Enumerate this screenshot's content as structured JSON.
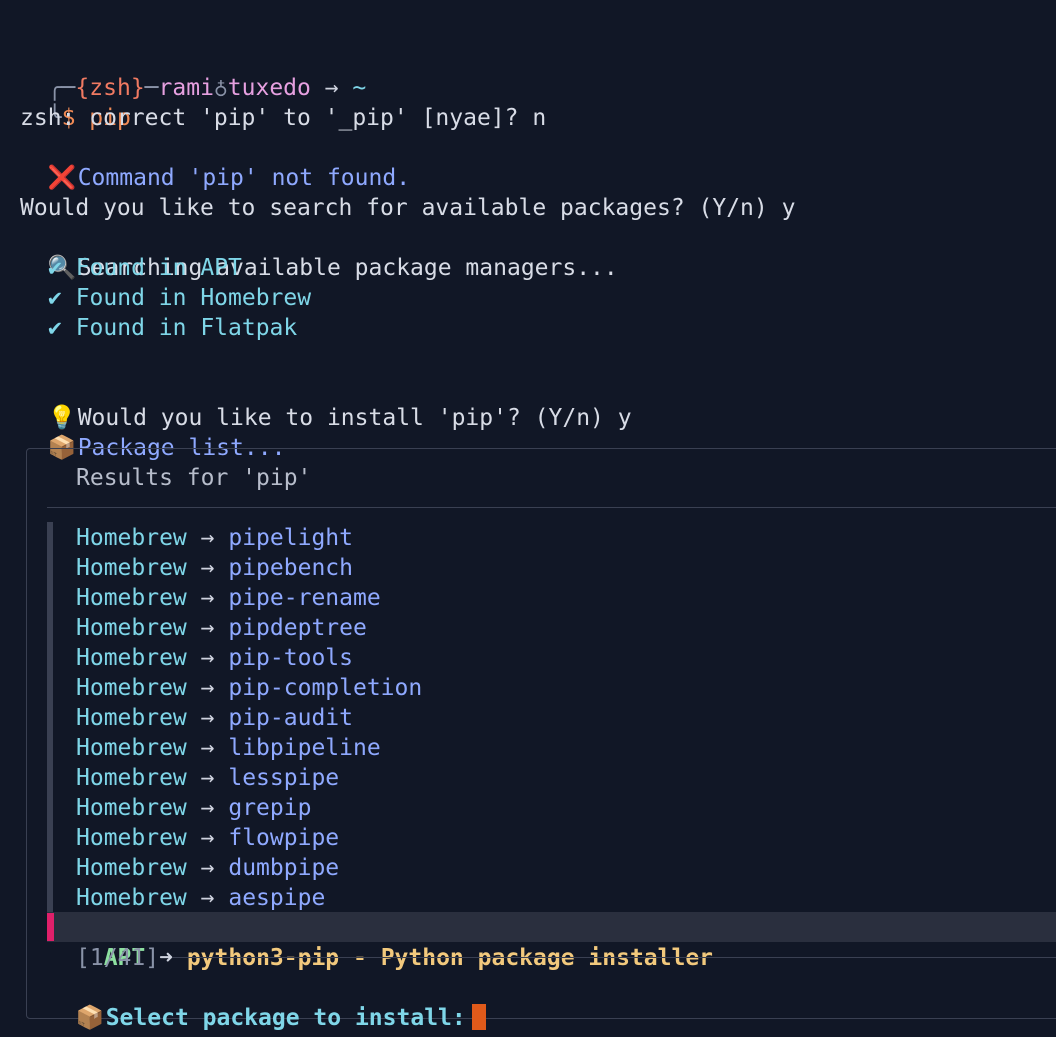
{
  "prompt": {
    "box_top": "╭─",
    "open": "{",
    "shell": "zsh",
    "close": "}",
    "dash": "─",
    "user": "rami",
    "at": "♁",
    "host": "tuxedo",
    "arrow": " → ",
    "cwd": "~",
    "box_bottom": "╰",
    "dollar": "$ ",
    "command": "pip"
  },
  "lines": {
    "correct": "zsh: correct 'pip' to '_pip' [nyae]? n",
    "not_found_icon": "❌",
    "not_found": "Command 'pip' not found.",
    "search_question": "Would you like to search for available packages? (Y/n) y",
    "searching_icon": "🔍",
    "searching": "Searching available package managers...",
    "found": [
      "✔ Found in APT",
      "✔ Found in Homebrew",
      "✔ Found in Flatpak"
    ],
    "install_icon": "💡",
    "install_question": "Would you like to install 'pip'? (Y/n) y",
    "list_icon": "📦",
    "list_title": "Package list..."
  },
  "picker": {
    "title": "Results for 'pip'",
    "arrow": "→",
    "items": [
      {
        "source": "Homebrew",
        "name": "pipelight"
      },
      {
        "source": "Homebrew",
        "name": "pipebench"
      },
      {
        "source": "Homebrew",
        "name": "pipe-rename"
      },
      {
        "source": "Homebrew",
        "name": "pipdeptree"
      },
      {
        "source": "Homebrew",
        "name": "pip-tools"
      },
      {
        "source": "Homebrew",
        "name": "pip-completion"
      },
      {
        "source": "Homebrew",
        "name": "pip-audit"
      },
      {
        "source": "Homebrew",
        "name": "libpipeline"
      },
      {
        "source": "Homebrew",
        "name": "lesspipe"
      },
      {
        "source": "Homebrew",
        "name": "grepip"
      },
      {
        "source": "Homebrew",
        "name": "flowpipe"
      },
      {
        "source": "Homebrew",
        "name": "dumbpipe"
      },
      {
        "source": "Homebrew",
        "name": "aespipe"
      }
    ],
    "selected": {
      "source": "APT",
      "arrow": "➜",
      "name": "python3-pip - Python package installer"
    },
    "counter": "[1/41]",
    "prompt_icon": "📦",
    "prompt": "Select package to install:"
  },
  "colors": {
    "background": "#111726",
    "selected_bar": "#e0206a",
    "cursor": "#e05a1a"
  }
}
